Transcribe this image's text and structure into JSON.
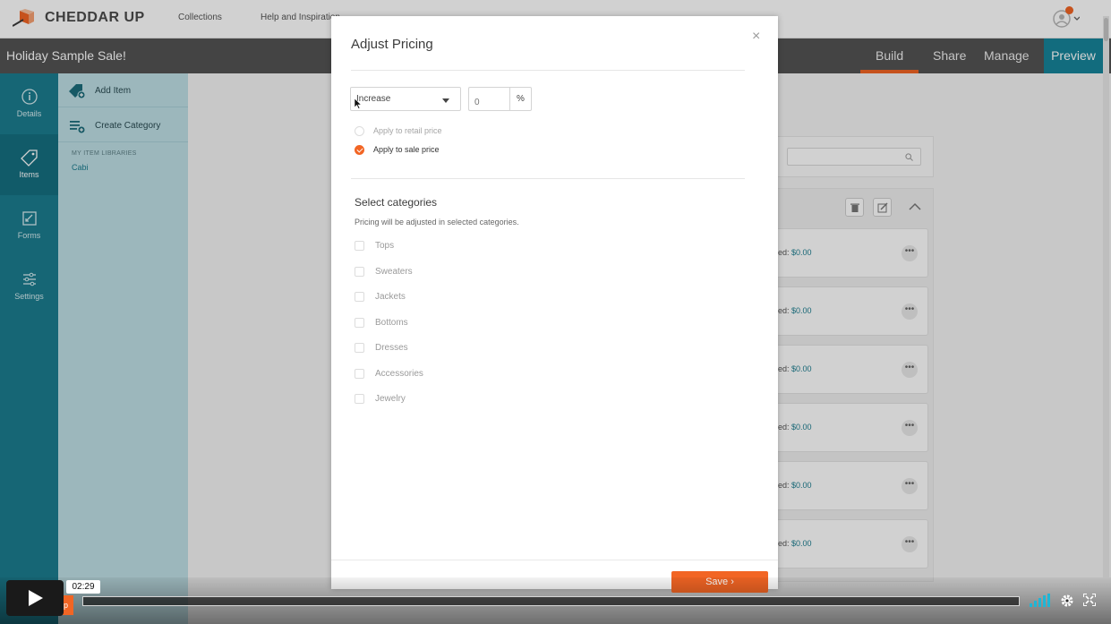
{
  "app": {
    "brand": "CHEDDAR UP",
    "nav": [
      "Collections",
      "Help and Inspiration"
    ]
  },
  "collection": {
    "title": "Holiday Sample Sale!",
    "tabs": [
      "Build",
      "Share",
      "Manage"
    ],
    "active_tab": "Build",
    "preview_label": "Preview"
  },
  "rail": {
    "items": [
      {
        "label": "Details",
        "icon": "info-icon"
      },
      {
        "label": "Items",
        "icon": "tag-icon"
      },
      {
        "label": "Forms",
        "icon": "form-icon"
      },
      {
        "label": "Settings",
        "icon": "sliders-icon"
      }
    ],
    "active": "Items"
  },
  "items_sidebar": {
    "add_item": "Add Item",
    "create_category": "Create Category",
    "libraries_heading": "MY ITEM LIBRARIES",
    "library": "Cabi"
  },
  "background_cards": {
    "label_fragment": "ed:",
    "price": "$0.00",
    "more": "•••",
    "count": 6
  },
  "modal": {
    "title": "Adjust Pricing",
    "close": "×",
    "direction": "Increase",
    "amount_placeholder": "0",
    "unit": "%",
    "price_options": [
      {
        "label": "Apply to retail price",
        "selected": false
      },
      {
        "label": "Apply to sale price",
        "selected": true
      }
    ],
    "categories_title": "Select categories",
    "categories_hint": "Pricing will be adjusted in selected categories.",
    "categories": [
      "Tops",
      "Sweaters",
      "Jackets",
      "Bottoms",
      "Dresses",
      "Accessories",
      "Jewelry"
    ],
    "save_label": "Save ›"
  },
  "player": {
    "time": "02:29",
    "help": "Help"
  },
  "colors": {
    "accent": "#f26524",
    "teal": "#1b7d8f",
    "title_bar": "#545454"
  }
}
